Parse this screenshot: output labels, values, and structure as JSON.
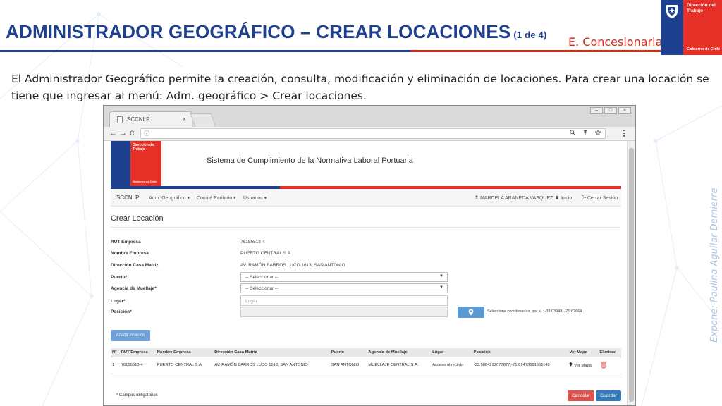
{
  "slide": {
    "title": "ADMINISTRADOR GEOGRÁFICO – CREAR LOCACIONES",
    "title_sub": "(1 de 4)",
    "company": "E. Concesionaria",
    "intro": "El Administrador Geográfico permite la creación, consulta, modificación y eliminación de locaciones. Para crear una locación se tiene que ingresar al menú: Adm. geográfico > Crear locaciones.",
    "credit": "Expone: Paulina Aguilar Demierre",
    "logo": {
      "line1": "Dirección del",
      "line2": "Trabajo",
      "footer": "Gobierno de Chile"
    }
  },
  "browser": {
    "tab_title": "SCCNLP",
    "tab_close": "×",
    "nav_back": "←",
    "nav_forward": "→",
    "nav_reload": "C",
    "address_info": "ⓘ",
    "win_min": "–",
    "win_max": "□",
    "win_close": "×"
  },
  "app": {
    "logo": {
      "line1": "Dirección del",
      "line2": "Trabajo",
      "footer": "Gobierno de Chile"
    },
    "system_title": "Sistema de Cumplimiento de la Normativa Laboral Portuaria",
    "nav": {
      "brand": "SCCNLP",
      "menu1": "Adm. Geográfico ▾",
      "menu2": "Comité Paritario ▾",
      "menu3": "Usuarios ▾",
      "user": "MARCELA ARANEDA VASQUEZ",
      "home": "Inicio",
      "logout": "Cerrar Sesión"
    },
    "page_heading": "Crear Locación",
    "form": {
      "rut_label": "RUT Empresa",
      "rut_value": "76156513-4",
      "name_label": "Nombre Empresa",
      "name_value": "PUERTO CENTRAL S.A",
      "address_label": "Dirección Casa Matriz",
      "address_value": "AV. RAMÓN BARROS LUCO 1613, SAN ANTONIO",
      "port_label": "Puerto*",
      "port_value": "-- Seleccionar --",
      "agency_label": "Agencia de Muellaje*",
      "agency_value": "-- Seleccionar --",
      "place_label": "Lugar*",
      "place_placeholder": "Lugar",
      "position_label": "Posición*",
      "position_hint": "Seleccione coordenadas, por ej.: -33.03948, -71.62664",
      "add_button": "Añadir locación"
    },
    "table": {
      "headers": [
        "N°",
        "RUT Empresa",
        "Nombre Empresa",
        "Dirección Casa Matriz",
        "Puerto",
        "Agencia de Muellaje",
        "Lugar",
        "Posición",
        "Ver Mapa",
        "Eliminar"
      ],
      "rows": [
        [
          "1",
          "76156513-4",
          "PUERTO CENTRAL S.A",
          "AV. RAMÓN BARROS LUCO 1613, SAN ANTONIO",
          "SAN ANTONIO",
          "MUELLAJE CENTRAL S.A.",
          "Acceso al recinto",
          "-33.5884292077877,-71.61473661661148",
          "Ver Mapa",
          ""
        ]
      ]
    },
    "required_note": "* Campos obligatorios",
    "cancel_button": "Cancelar",
    "save_button": "Guardar"
  },
  "colors": {
    "brand_blue": "#1f3f8f",
    "brand_red": "#e63027",
    "accent_red": "#d52b1e",
    "primary": "#337ab7",
    "danger": "#d9534f"
  }
}
